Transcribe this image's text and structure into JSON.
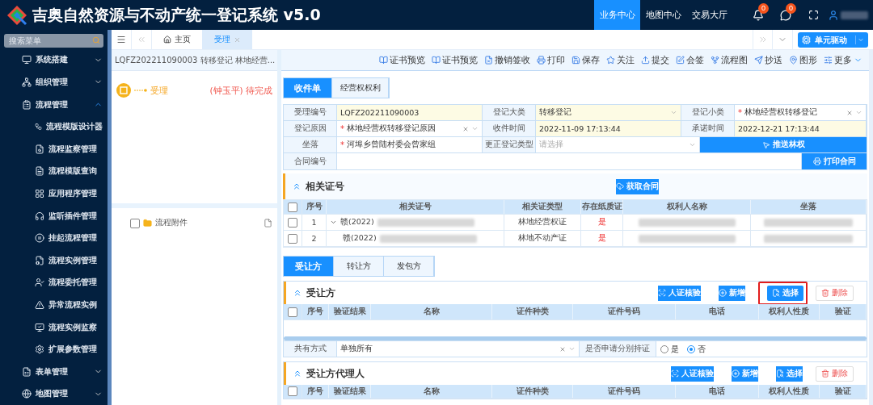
{
  "header": {
    "title": "吉奥自然资源与不动产统一登记系统 v5.0",
    "nav": [
      {
        "label": "业务中心",
        "selected": true
      },
      {
        "label": "地图中心",
        "selected": false
      },
      {
        "label": "交易大厅",
        "selected": false
      }
    ],
    "notifications": "0",
    "messages": "0"
  },
  "sidebar": {
    "search_placeholder": "搜索菜单",
    "items": [
      {
        "label": "系统搭建",
        "expanded": false
      },
      {
        "label": "组织管理",
        "expanded": false
      },
      {
        "label": "流程管理",
        "expanded": true,
        "children": [
          {
            "label": "流程模版设计器"
          },
          {
            "label": "流程监察管理"
          },
          {
            "label": "流程模版查询"
          },
          {
            "label": "应用程序管理"
          },
          {
            "label": "监听插件管理"
          },
          {
            "label": "挂起流程管理"
          },
          {
            "label": "流程实例管理"
          },
          {
            "label": "流程委托管理"
          },
          {
            "label": "异常流程实例"
          },
          {
            "label": "流程实例监察"
          },
          {
            "label": "扩展参数管理"
          }
        ]
      },
      {
        "label": "表单管理",
        "expanded": false
      },
      {
        "label": "地图管理",
        "expanded": false
      }
    ]
  },
  "tabs": [
    {
      "label": "主页",
      "selected": false
    },
    {
      "label": "受理",
      "selected": true
    }
  ],
  "unit_button": "单元驱动",
  "left_panel": {
    "title": "LQFZ202211090003 转移登记 林地经营...",
    "step": "受理",
    "handler": "(钟玉平) 待完成",
    "attachments": [
      {
        "label": "流程附件",
        "checked": false
      }
    ]
  },
  "toolbar": [
    "证书预览",
    "证书预览",
    "撤销签收",
    "打印",
    "保存",
    "关注",
    "提交",
    "会签",
    "流程图",
    "抄送",
    "图形",
    "更多"
  ],
  "form_tabs": [
    {
      "label": "收件单",
      "selected": true
    },
    {
      "label": "经营权权利",
      "selected": false
    }
  ],
  "form": {
    "rows": [
      [
        {
          "kind": "field",
          "label": "受理编号",
          "value": "LQFZ202211090003",
          "readonly": true
        },
        {
          "kind": "select",
          "label": "登记大类",
          "value": "转移登记",
          "readonly": true
        },
        {
          "kind": "select",
          "label": "登记小类",
          "value": "林地经营权转移登记",
          "readonly": false,
          "mark": "*",
          "clearable": true
        }
      ],
      [
        {
          "kind": "select",
          "label": "登记原因",
          "value": "林地经营权转移登记原因",
          "readonly": false,
          "mark": "*",
          "clearable": true
        },
        {
          "kind": "field",
          "label": "收件时间",
          "value": "2022-11-09 17:13:44",
          "readonly": true
        },
        {
          "kind": "field",
          "label": "承诺时间",
          "value": "2022-12-21 17:13:44",
          "readonly": true
        }
      ],
      [
        {
          "kind": "field",
          "label": "坐落",
          "value": "河埠乡曾陆村委会曾家组",
          "readonly": false,
          "mark": "*"
        },
        {
          "kind": "select",
          "label": "更正登记类型",
          "placeholder": "请选择",
          "readonly": false
        },
        {
          "kind": "action",
          "label": "推送林权"
        }
      ],
      [
        {
          "kind": "field",
          "label": "合同编号",
          "readonly": false
        },
        {
          "kind": "action",
          "label": "打印合同"
        }
      ]
    ]
  },
  "related": {
    "title": "相关证号",
    "button": "获取合同",
    "all_checked": false,
    "columns": [
      "序号",
      "相关证号",
      "相关证类型",
      "存在纸质证",
      "权利人名称",
      "坐落"
    ],
    "rows": [
      {
        "no": "1",
        "cert": "赣(2022)",
        "type": "林地经营权证",
        "paper": "是",
        "checked": false,
        "expanded": true,
        "children": [
          {
            "no": "2",
            "cert": "赣(2022)",
            "type": "林地不动产证",
            "paper": "是",
            "checked": false
          }
        ]
      }
    ]
  },
  "party_tabs": [
    {
      "label": "受让方",
      "selected": true
    },
    {
      "label": "转让方",
      "selected": false
    },
    {
      "label": "发包方",
      "selected": false
    }
  ],
  "sections": [
    {
      "title": "受让方",
      "all_checked": false,
      "buttons": [
        {
          "kind": "verify",
          "label": "人证核验",
          "highlighted": false
        },
        {
          "kind": "add",
          "label": "新增",
          "highlighted": false
        },
        {
          "kind": "select",
          "label": "选择",
          "highlighted": true
        },
        {
          "kind": "delete",
          "label": "删除",
          "highlighted": false
        }
      ],
      "columns": [
        "序号",
        "验证结果",
        "名称",
        "证件种类",
        "证件号码",
        "电话",
        "权利人性质",
        "验证"
      ],
      "ownership": {
        "label": "共有方式",
        "value": "单独所有",
        "question": "是否申请分别持证",
        "options": [
          {
            "label": "是",
            "selected": false
          },
          {
            "label": "否",
            "selected": true
          }
        ]
      }
    },
    {
      "title": "受让方代理人",
      "all_checked": false,
      "buttons": [
        {
          "kind": "verify",
          "label": "人证核验",
          "highlighted": false
        },
        {
          "kind": "add",
          "label": "新增",
          "highlighted": false
        },
        {
          "kind": "select",
          "label": "选择",
          "highlighted": false
        },
        {
          "kind": "delete",
          "label": "删除",
          "highlighted": false
        }
      ],
      "columns": [
        "序号",
        "验证结果",
        "名称",
        "证件种类",
        "证件号码",
        "电话",
        "权利人性质",
        "验证"
      ]
    }
  ]
}
